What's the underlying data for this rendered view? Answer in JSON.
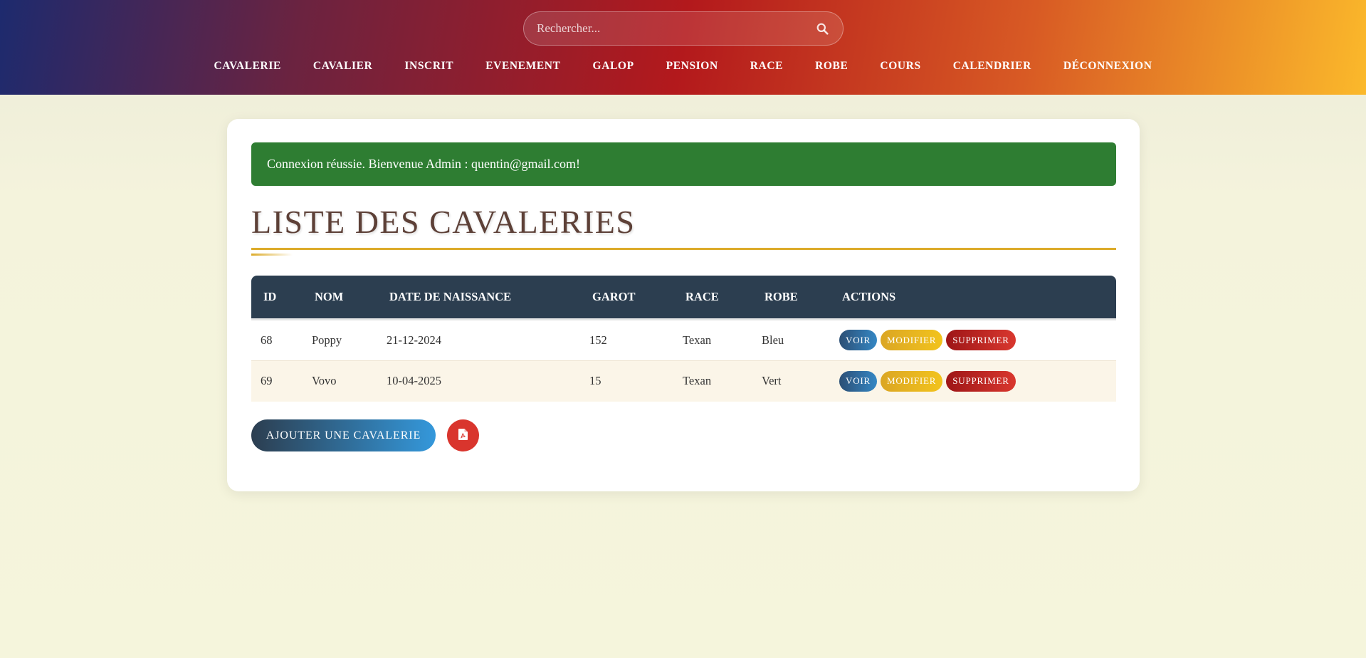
{
  "header": {
    "search": {
      "placeholder": "Rechercher...",
      "icon": "search-icon"
    },
    "nav": [
      {
        "label": "CAVALERIE"
      },
      {
        "label": "CAVALIER"
      },
      {
        "label": "INSCRIT"
      },
      {
        "label": "EVENEMENT"
      },
      {
        "label": "GALOP"
      },
      {
        "label": "PENSION"
      },
      {
        "label": "RACE"
      },
      {
        "label": "ROBE"
      },
      {
        "label": "COURS"
      },
      {
        "label": "CALENDRIER"
      },
      {
        "label": "DÉCONNEXION"
      }
    ]
  },
  "alert": {
    "text": "Connexion réussie. Bienvenue Admin : quentin@gmail.com!",
    "color": "#2e7d32"
  },
  "page_title": "LISTE DES CAVALERIES",
  "table": {
    "headers": [
      "ID",
      "NOM",
      "DATE DE NAISSANCE",
      "GAROT",
      "RACE",
      "ROBE",
      "ACTIONS"
    ],
    "rows": [
      {
        "id": "68",
        "nom": "Poppy",
        "date": "21-12-2024",
        "garot": "152",
        "race": "Texan",
        "robe": "Bleu"
      },
      {
        "id": "69",
        "nom": "Vovo",
        "date": "10-04-2025",
        "garot": "15",
        "race": "Texan",
        "robe": "Vert"
      }
    ],
    "actions": {
      "voir": "VOIR",
      "modifier": "MODIFIER",
      "supprimer": "SUPPRIMER"
    }
  },
  "buttons": {
    "add": "AJOUTER UNE CAVALERIE",
    "pdf_icon": "pdf-file-icon"
  },
  "colors": {
    "table_header": "#2c3e50",
    "accent": "#dcab2a",
    "title": "#5d4037"
  }
}
